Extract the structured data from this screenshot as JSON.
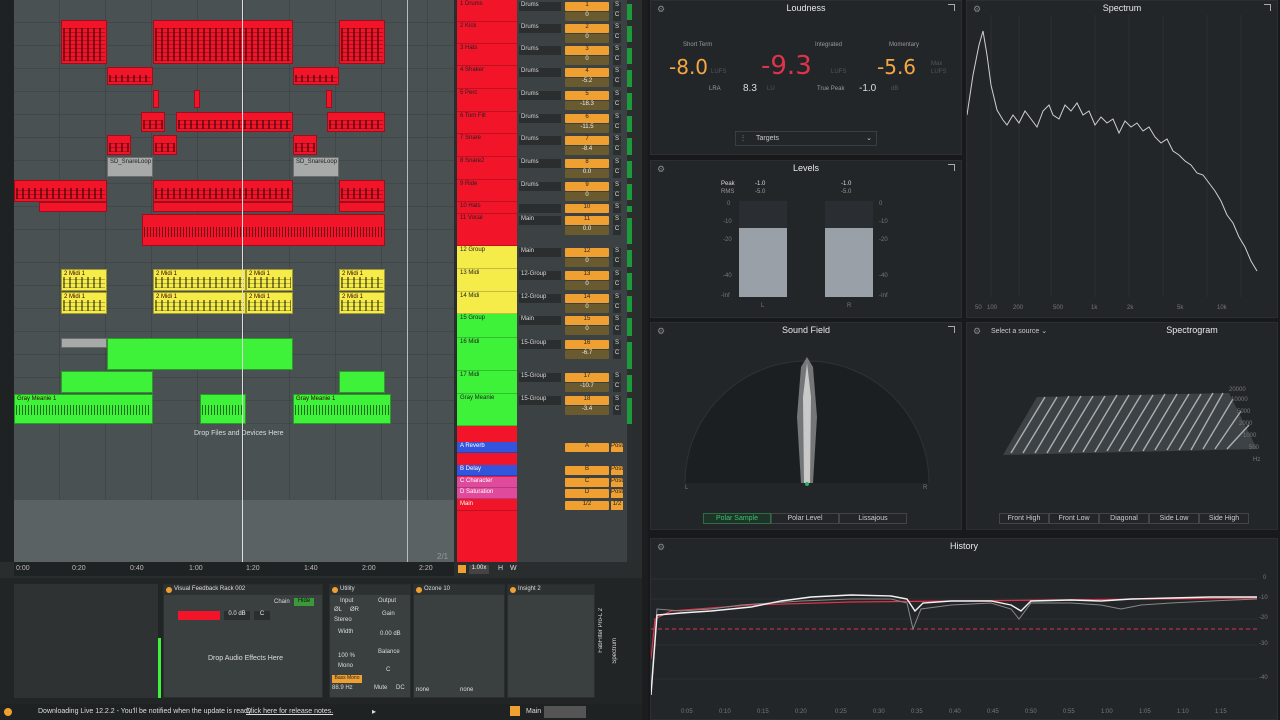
{
  "arrangement": {
    "clips": {
      "snare1": "SD_SnareLoop",
      "snare2": "SD_SnareLoop",
      "midi_a1": "2 Midi 1",
      "midi_a2": "2 Midi 1",
      "midi_a3": "2 Midi 1",
      "midi_a4": "2 Midi 1",
      "midi_b1": "2 Midi 1",
      "midi_b2": "2 Midi 1",
      "midi_b3": "2 Midi 1",
      "midi_b4": "2 Midi 1",
      "gray1": "Gray Meanie 1",
      "gray2": "Gray Meanie 1"
    },
    "drop_hint": "Drop Files and Devices Here",
    "page_indicator": "2/1",
    "ruler": [
      "0:00",
      "0:20",
      "0:40",
      "1:00",
      "1:20",
      "1:40",
      "2:00",
      "2:20"
    ],
    "zoom": "1.00x",
    "h_btn": "H",
    "w_btn": "W"
  },
  "tracks": [
    {
      "name": "1 Drums",
      "type": "Drums",
      "num": "1",
      "vol": "0"
    },
    {
      "name": "2 Kick",
      "type": "Drums",
      "num": "2",
      "vol": "0"
    },
    {
      "name": "3 Hats",
      "type": "Drums",
      "num": "3",
      "vol": "0"
    },
    {
      "name": "4 Shaker",
      "type": "Drums",
      "num": "4",
      "vol": "-5.2"
    },
    {
      "name": "5 Perc",
      "type": "Drums",
      "num": "5",
      "vol": "-18.3"
    },
    {
      "name": "6 Tom Fill",
      "type": "Drums",
      "num": "6",
      "vol": "-11.5"
    },
    {
      "name": "7 Snare",
      "type": "Drums",
      "num": "7",
      "vol": "-8.4"
    },
    {
      "name": "8 Snare2",
      "type": "Drums",
      "num": "8",
      "vol": "0.0"
    },
    {
      "name": "9 Ride",
      "type": "Drums",
      "num": "9",
      "vol": "0"
    },
    {
      "name": "10 Hats",
      "type": "",
      "num": "10",
      "vol": "0"
    },
    {
      "name": "11 Vocal",
      "type": "Main",
      "num": "11",
      "vol": "0.0"
    },
    {
      "name": "12 Group",
      "type": "Main",
      "num": "12",
      "vol": "0"
    },
    {
      "name": "13 Midi",
      "type": "12-Group",
      "num": "13",
      "vol": "0"
    },
    {
      "name": "14 Midi",
      "type": "12-Group",
      "num": "14",
      "vol": "0"
    },
    {
      "name": "15 Group",
      "type": "Main",
      "num": "15",
      "vol": "0"
    },
    {
      "name": "16 Midi",
      "type": "15-Group",
      "num": "16",
      "vol": "-6.7"
    },
    {
      "name": "17 Midi",
      "type": "15-Group",
      "num": "17",
      "vol": "-10.7"
    },
    {
      "name": "Gray Meanie",
      "type": "15-Group",
      "num": "18",
      "vol": "-3.4"
    }
  ],
  "returns": [
    {
      "name": "A Reverb",
      "num": "A",
      "label": "Post"
    },
    {
      "name": "B Delay",
      "num": "B",
      "label": "Post"
    },
    {
      "name": "C Character",
      "num": "C",
      "label": "Post"
    },
    {
      "name": "D Saturation",
      "num": "D",
      "label": "Post"
    },
    {
      "name": "Main",
      "num": "1/2",
      "label": "1/2"
    }
  ],
  "mixer_extra": {
    "in": "In",
    "auto": "Auto",
    "off": "Off",
    "pan1": "15L",
    "pan2": "14R",
    "pan3": "29R",
    "vol_main": "-3.0"
  },
  "devices": {
    "rack": "Visual Feedback Rack 002",
    "chain": "Chain",
    "hide": "Hide",
    "chain_vol": "0.0 dB",
    "chain_c": "C",
    "drop": "Drop Audio Effects Here",
    "utility": "Utility",
    "input": "Input",
    "output": "Output",
    "phase_l": "ØL",
    "phase_r": "ØR",
    "stereo": "Stereo",
    "width": "Width",
    "width_val": "100 %",
    "mono": "Mono",
    "gain": "Gain",
    "gain_val": "0.00 dB",
    "balance": "Balance",
    "bal_val": "C",
    "bass_mono": "Bass Mono",
    "bass_freq": "88.9 Hz",
    "mute": "Mute",
    "dc": "DC",
    "ozone": "Ozone 10",
    "insight": "Insight 2",
    "none1": "none",
    "none2": "none",
    "fabfilter": "FabFilter Pro-L 2",
    "spectrum": "Spectrum"
  },
  "status": {
    "message": "Downloading Live 12.2.2 - You'll be notified when the update is ready.",
    "link": "Click here for release notes.",
    "main": "Main"
  },
  "insight": {
    "loudness": {
      "title": "Loudness",
      "short_label": "Short Term",
      "short": "-8.0",
      "int_label": "Integrated",
      "int": "-9.3",
      "mom_label": "Momentary",
      "mom": "-5.6",
      "lufs1": "LUFS",
      "lufs2": "LUFS",
      "max": "Max",
      "lufs3": "LUFS",
      "lra_label": "LRA",
      "lra": "8.3",
      "lu": "LU",
      "tp_label": "True Peak",
      "tp": "-1.0",
      "db": "dB",
      "targets": "Targets"
    },
    "spectrum": {
      "title": "Spectrum",
      "xticks": [
        "50",
        "100",
        "200",
        "500",
        "1k",
        "2k",
        "5k",
        "10k"
      ]
    },
    "levels": {
      "title": "Levels",
      "peak": "Peak",
      "rms": "RMS",
      "peak_l": "-1.0",
      "rms_l": "-5.0",
      "peak_r": "-1.0",
      "rms_r": "-5.0",
      "ticks": [
        "0",
        "-10",
        "-20",
        "-40",
        "-Inf"
      ],
      "l": "L",
      "r": "R",
      "left_level": 0.72,
      "right_level": 0.72
    },
    "soundfield": {
      "title": "Sound Field",
      "modes": [
        "Polar Sample",
        "Polar Level",
        "Lissajous"
      ],
      "l": "L",
      "r": "R"
    },
    "spectrogram": {
      "title": "Spectrogram",
      "source": "Select a source",
      "freqs": [
        "20000",
        "10000",
        "5000",
        "2000",
        "1000",
        "500",
        "Hz"
      ]
    },
    "spectrogram_modes": [
      "Front High",
      "Front Low",
      "Diagonal",
      "Side Low",
      "Side High"
    ],
    "history": {
      "title": "History",
      "xticks": [
        "0:05",
        "0:10",
        "0:15",
        "0:20",
        "0:25",
        "0:30",
        "0:35",
        "0:40",
        "0:45",
        "0:50",
        "0:55",
        "1:00",
        "1:05",
        "1:10",
        "1:15"
      ],
      "yticks": [
        "0",
        "-10",
        "-20",
        "-30",
        "-40"
      ]
    }
  },
  "colors": {
    "red": "#f2152a",
    "yellow": "#f5ec4a",
    "green": "#3ef23a",
    "blue": "#3355dd",
    "pink": "#e04a9c",
    "accent": "#f0a030",
    "integrated": "#e0334a",
    "lufs_val": "#f5a742"
  }
}
